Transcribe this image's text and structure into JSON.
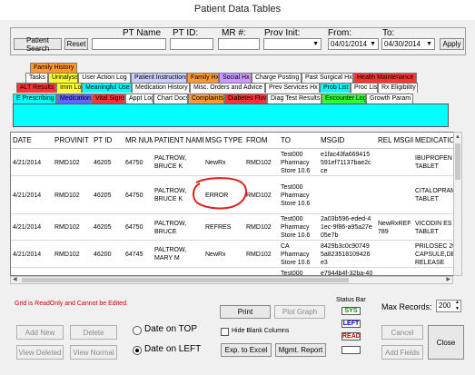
{
  "window": {
    "title": "Patient Data Tables"
  },
  "filters": {
    "search_button": "Patient Search",
    "reset_button": "Reset",
    "pt_name_label": "PT Name",
    "pt_id_label": "PT ID:",
    "mr_label": "MR #:",
    "prov_init_label": "Prov Init:",
    "from_label": "From:",
    "to_label": "To:",
    "from_value": "04/01/2014",
    "to_value": "04/30/2014",
    "apply_button": "Apply"
  },
  "tabs": {
    "row1": [
      {
        "label": "Family History",
        "color": "#ff9933"
      }
    ],
    "row2": [
      {
        "label": "Tasks",
        "color": "#ffffff"
      },
      {
        "label": "Urinalysis",
        "color": "#ffff33"
      },
      {
        "label": "User Action Log",
        "color": "#ffffff"
      },
      {
        "label": "Patient Instructions",
        "color": "#ccccff"
      },
      {
        "label": "Family Hx",
        "color": "#ff9933"
      },
      {
        "label": "Social Hx",
        "color": "#cc99ff"
      },
      {
        "label": "Charge Posting",
        "color": "#ffffff"
      },
      {
        "label": "Past Surgical Hx",
        "color": "#ffffff"
      },
      {
        "label": "Health Maintenance",
        "color": "#ff3333"
      }
    ],
    "row3": [
      {
        "label": "ALT Results",
        "color": "#ff3333"
      },
      {
        "label": "Imm Log",
        "color": "#ffff33"
      },
      {
        "label": "Meaningful Use",
        "color": "#00ffff"
      },
      {
        "label": "Medication History",
        "color": "#ffffff"
      },
      {
        "label": "Misc. Orders and Advice",
        "color": "#ffffff"
      },
      {
        "label": "Prev Services Hx",
        "color": "#ffffff"
      },
      {
        "label": "Prob List",
        "color": "#00ffff"
      },
      {
        "label": "Proc List",
        "color": "#ffffff"
      },
      {
        "label": "Rx Eligibility",
        "color": "#ffffff"
      }
    ],
    "row4": [
      {
        "label": "E Prescribing",
        "color": "#00ffff"
      },
      {
        "label": "Medication",
        "color": "#6666ff"
      },
      {
        "label": "Vital Signs",
        "color": "#ff3333"
      },
      {
        "label": "Appt Log",
        "color": "#ffffff"
      },
      {
        "label": "Chart Docs",
        "color": "#ffffff"
      },
      {
        "label": "Complaints",
        "color": "#ff9933"
      },
      {
        "label": "Diabetes Flow",
        "color": "#ff3333"
      },
      {
        "label": "Diag Test Results",
        "color": "#ffffff"
      },
      {
        "label": "Encounter Log",
        "color": "#33ff33"
      },
      {
        "label": "Growth Param",
        "color": "#ffffff"
      }
    ]
  },
  "grid": {
    "columns": [
      "DATE",
      "PROVINIT",
      "PT ID",
      "MR NUM",
      "PATIENT NAME",
      "MSG TYPE",
      "FROM",
      "TO",
      "MSGID",
      "REL MSGID",
      "MEDICATION"
    ],
    "rows": [
      [
        "4/21/2014",
        "RMD102",
        "46205",
        "64750",
        "PALTROW,\nBRUCE K",
        "NewRx",
        "RMD102",
        "Test000\nPharmacy\nStore 10.6",
        "e1fac43fa669415\n591ef71137bae2c\nce",
        "",
        "IBUPROFEN\nTABLET"
      ],
      [
        "4/21/2014",
        "RMD102",
        "46205",
        "64750",
        "PALTROW,\nBRUCE K",
        "ERROR",
        "RMD102",
        "Test000\nPharmacy\nStore 10.6",
        "",
        "",
        "CITALOPRAM\nTABLET"
      ],
      [
        "4/21/2014",
        "RMD102",
        "46205",
        "64750",
        "PALTROW,\nBRUCE",
        "REFRES",
        "RMD102",
        "Test000\nPharmacy\nStore 10.6",
        "2a03b596-eded-4\n1ec-9f86-a95a27e\n05e7b",
        "NewRxREF\n789",
        "VICODIN ES 7\nTABLET"
      ],
      [
        "4/21/2014",
        "RMD102",
        "46200",
        "64745",
        "PALTROW,\nMARY M",
        "NewRx",
        "RMD102",
        "CA\nPharmacy\nStore 10.6",
        "8429b3c0c90749\n5a823518109426\ne3",
        "",
        "PRILOSEC 20\nCAPSULE,DE\nRELEASE"
      ],
      [
        "",
        "",
        "",
        "",
        "",
        "",
        "",
        "Test000",
        "e7944b4f-32ba-40",
        "",
        ""
      ]
    ]
  },
  "bottom": {
    "readonly_notice": "Grid is ReadOnly and Cannot be Edited.",
    "add_new": "Add New",
    "delete": "Delete",
    "view_deleted": "View Deleted",
    "view_normal": "View Normal",
    "date_on_top": "Date on TOP",
    "date_on_left": "Date on LEFT",
    "print": "Print",
    "plot_graph": "Plot Graph",
    "hide_blank_columns": "Hide Blank Columns",
    "exp_to_excel": "Exp. to Excel",
    "mgmt_report": "Mgmt. Report",
    "status_bar_label": "Status Bar",
    "status_sys": "SYS",
    "status_left": "LEFT",
    "status_read": "READ",
    "max_records_label": "Max Records:",
    "max_records_value": "200",
    "cancel": "Cancel",
    "add_fields": "Add Fields",
    "close": "Close"
  },
  "colors": {
    "accent": "#00ffff",
    "annotation": "#e0201e",
    "notice": "#cc0000"
  }
}
